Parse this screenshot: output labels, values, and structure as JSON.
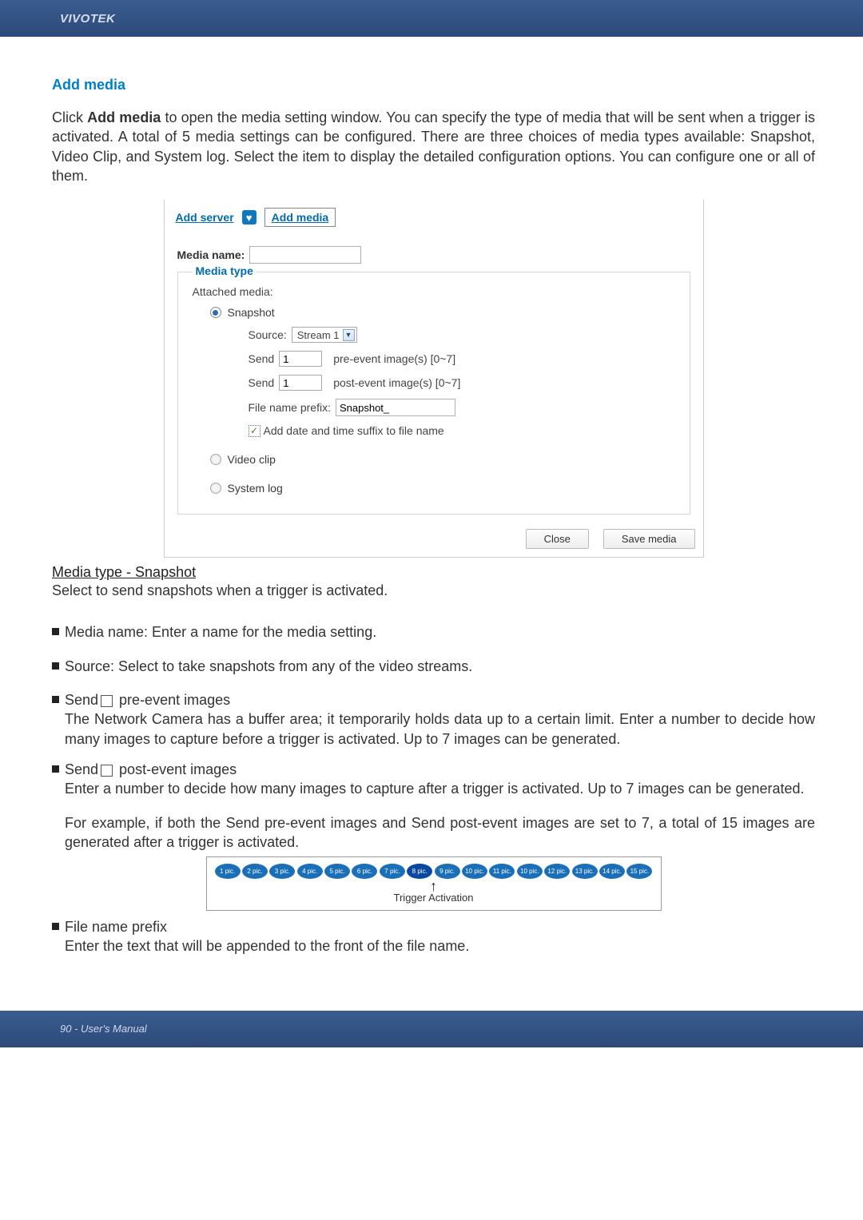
{
  "header": {
    "brand": "VIVOTEK"
  },
  "section": {
    "title": "Add media"
  },
  "intro": {
    "prefix": "Click ",
    "bold": "Add media",
    "rest": " to open the media setting window. You can specify the type of media that will be sent when a trigger is activated. A total of 5 media settings can be configured. There are three choices of media types available: Snapshot, Video Clip, and System log. Select the item to display the detailed configuration options. You can configure one or all of them."
  },
  "dialog": {
    "tabs": {
      "server": "Add server",
      "status_glyph": "♥",
      "media": "Add media"
    },
    "media_name_label": "Media name:",
    "media_name_value": "",
    "media_type_legend": "Media type",
    "attached_label": "Attached media:",
    "radios": {
      "snapshot": "Snapshot",
      "video": "Video clip",
      "system": "System log"
    },
    "snapshot": {
      "source_label": "Source:",
      "source_value": "Stream 1",
      "send_label": "Send",
      "pre_value": "1",
      "pre_suffix": "pre-event image(s) [0~7]",
      "post_value": "1",
      "post_suffix": "post-event image(s) [0~7]",
      "prefix_label": "File name prefix:",
      "prefix_value": "Snapshot_",
      "suffix_checkbox": "Add date and time suffix to file name",
      "check_glyph": "✓"
    },
    "buttons": {
      "close": "Close",
      "save": "Save media"
    }
  },
  "explain": {
    "heading": "Media type - Snapshot",
    "sub": "Select to send snapshots when a trigger is activated.",
    "b_media_name": "Media name: Enter a name for the media setting.",
    "b_source": "Source: Select to take snapshots from any of the video streams.",
    "b_send_pre_label": "Send",
    "b_send_pre_suffix": " pre-event images",
    "b_send_pre_para": "The Network Camera has a buffer area; it temporarily holds data up to a certain limit. Enter a number to decide how many images to capture before a trigger is activated. Up to 7 images can be generated.",
    "b_send_post_label": "Send",
    "b_send_post_suffix": " post-event images",
    "b_send_post_para": "Enter a number to decide how many images to capture after a trigger is activated. Up to 7 images can be generated.",
    "b_example": "For example, if both the Send pre-event images and Send post-event images are set to 7, a total of 15 images are generated after a trigger is activated.",
    "b_file_prefix": "File name prefix",
    "b_file_prefix_para": "Enter the text that will be appended to the front of the file name."
  },
  "diagram": {
    "pics": [
      "1 pic.",
      "2 pic.",
      "3 pic.",
      "4 pic.",
      "5 pic.",
      "6 pic.",
      "7 pic.",
      "8 pic.",
      "9 pic.",
      "10 pic.",
      "11 pic.",
      "10 pic.",
      "12 pic.",
      "13 pic.",
      "14 pic.",
      "15 pic."
    ],
    "trigger_label": "Trigger Activation"
  },
  "footer": {
    "text": "90 - User's Manual"
  }
}
